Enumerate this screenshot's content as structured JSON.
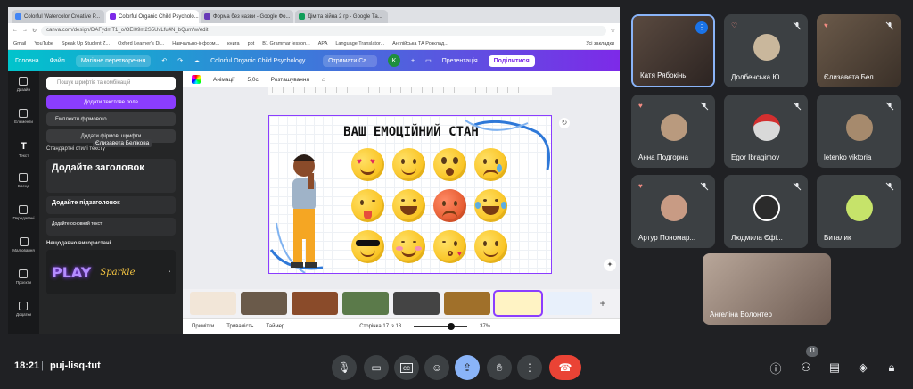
{
  "browser": {
    "tabs": [
      {
        "label": "Colorful Watercolor Creative P..."
      },
      {
        "label": "Colorful Organic Child Psycholo..."
      },
      {
        "label": "Форма без назви - Google Фо..."
      },
      {
        "label": "Дім та війна 2 гр - Google Та..."
      }
    ],
    "url": "canva.com/design/DAFydmT1_o/OEl09m2S5UvLfu4N_bQum/w/edit",
    "bookmarks": [
      "Gmail",
      "YouTube",
      "Speak Up Student Z...",
      "Oxford Learner's Di...",
      "Навчально-інформ...",
      "книга",
      "ppt",
      "B1 Grammar lesson...",
      "APA",
      "Language Translator...",
      "Англійська ТА Розклад...",
      "Усі закладки"
    ]
  },
  "canva": {
    "menu": [
      "Головна",
      "Файл"
    ],
    "magic": "Магічне перетворення",
    "doc_title": "Colorful Organic Child Psychology ...",
    "get_btn": "Отримати Ca...",
    "avatar_k": "K",
    "present": "Презентація",
    "share": "Поділитися",
    "rail": [
      "Дизайн",
      "Елементи",
      "Текст",
      "Бренд",
      "Передавані",
      "Малювання",
      "Проєкти",
      "Додатки"
    ],
    "search_placeholder": "Пошук шрифтів та комбінацій",
    "add_text_btn": "Додати текстове поле",
    "brand_kit": "Емплекти фірмового ...",
    "brand_fonts": "Додати фірмові шрифти",
    "default_styles": "Стандартні стилі тексту",
    "heading": "Додайте заголовок",
    "subheading": "Додайте підзаголовок",
    "body": "Додайте основний текст",
    "recent": "Нещодавно використані",
    "sample_play": "PLAY",
    "sample_sparkle": "Sparkle",
    "toolbar": [
      "Анімації",
      "5,0с",
      "Розташування"
    ],
    "slide_title": "ВАШ ЕМОЦІЙНИЙ СТАН",
    "status": {
      "notes": "Примітки",
      "duration": "Тривалість",
      "timer": "Таймер",
      "page": "Сторінка 17 із 18",
      "zoom": "37%"
    },
    "cursor_label": "Єлизавета Белікова"
  },
  "participants": [
    {
      "name": "Катя Рябокінь",
      "speaking": true
    },
    {
      "name": "Долбенська Ю..."
    },
    {
      "name": "Єлизавета Бел..."
    },
    {
      "name": "Анна Подгорна"
    },
    {
      "name": "Egor Ibragimov"
    },
    {
      "name": "letenko viktoria"
    },
    {
      "name": "Артур Пономар..."
    },
    {
      "name": "Людмила Єфі..."
    },
    {
      "name": "Виталик"
    },
    {
      "name": "Ангеліна Волонтер"
    }
  ],
  "meet": {
    "time": "18:21",
    "meeting_code": "puj-lisq-tut",
    "people_count": "11",
    "colors": {
      "end_call": "#ea4335",
      "active": "#8ab4f8",
      "tile": "#3c4043"
    }
  }
}
